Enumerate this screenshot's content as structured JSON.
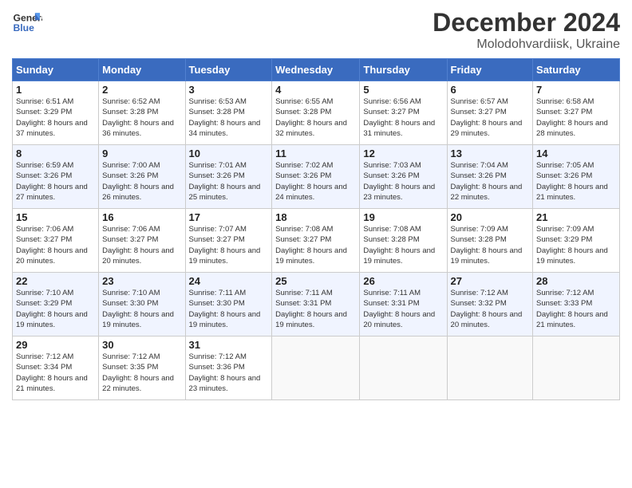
{
  "header": {
    "logo_line1": "General",
    "logo_line2": "Blue",
    "month": "December 2024",
    "location": "Molodohvardiisk, Ukraine"
  },
  "weekdays": [
    "Sunday",
    "Monday",
    "Tuesday",
    "Wednesday",
    "Thursday",
    "Friday",
    "Saturday"
  ],
  "weeks": [
    [
      {
        "day": "1",
        "sunrise": "Sunrise: 6:51 AM",
        "sunset": "Sunset: 3:29 PM",
        "daylight": "Daylight: 8 hours and 37 minutes."
      },
      {
        "day": "2",
        "sunrise": "Sunrise: 6:52 AM",
        "sunset": "Sunset: 3:28 PM",
        "daylight": "Daylight: 8 hours and 36 minutes."
      },
      {
        "day": "3",
        "sunrise": "Sunrise: 6:53 AM",
        "sunset": "Sunset: 3:28 PM",
        "daylight": "Daylight: 8 hours and 34 minutes."
      },
      {
        "day": "4",
        "sunrise": "Sunrise: 6:55 AM",
        "sunset": "Sunset: 3:28 PM",
        "daylight": "Daylight: 8 hours and 32 minutes."
      },
      {
        "day": "5",
        "sunrise": "Sunrise: 6:56 AM",
        "sunset": "Sunset: 3:27 PM",
        "daylight": "Daylight: 8 hours and 31 minutes."
      },
      {
        "day": "6",
        "sunrise": "Sunrise: 6:57 AM",
        "sunset": "Sunset: 3:27 PM",
        "daylight": "Daylight: 8 hours and 29 minutes."
      },
      {
        "day": "7",
        "sunrise": "Sunrise: 6:58 AM",
        "sunset": "Sunset: 3:27 PM",
        "daylight": "Daylight: 8 hours and 28 minutes."
      }
    ],
    [
      {
        "day": "8",
        "sunrise": "Sunrise: 6:59 AM",
        "sunset": "Sunset: 3:26 PM",
        "daylight": "Daylight: 8 hours and 27 minutes."
      },
      {
        "day": "9",
        "sunrise": "Sunrise: 7:00 AM",
        "sunset": "Sunset: 3:26 PM",
        "daylight": "Daylight: 8 hours and 26 minutes."
      },
      {
        "day": "10",
        "sunrise": "Sunrise: 7:01 AM",
        "sunset": "Sunset: 3:26 PM",
        "daylight": "Daylight: 8 hours and 25 minutes."
      },
      {
        "day": "11",
        "sunrise": "Sunrise: 7:02 AM",
        "sunset": "Sunset: 3:26 PM",
        "daylight": "Daylight: 8 hours and 24 minutes."
      },
      {
        "day": "12",
        "sunrise": "Sunrise: 7:03 AM",
        "sunset": "Sunset: 3:26 PM",
        "daylight": "Daylight: 8 hours and 23 minutes."
      },
      {
        "day": "13",
        "sunrise": "Sunrise: 7:04 AM",
        "sunset": "Sunset: 3:26 PM",
        "daylight": "Daylight: 8 hours and 22 minutes."
      },
      {
        "day": "14",
        "sunrise": "Sunrise: 7:05 AM",
        "sunset": "Sunset: 3:26 PM",
        "daylight": "Daylight: 8 hours and 21 minutes."
      }
    ],
    [
      {
        "day": "15",
        "sunrise": "Sunrise: 7:06 AM",
        "sunset": "Sunset: 3:27 PM",
        "daylight": "Daylight: 8 hours and 20 minutes."
      },
      {
        "day": "16",
        "sunrise": "Sunrise: 7:06 AM",
        "sunset": "Sunset: 3:27 PM",
        "daylight": "Daylight: 8 hours and 20 minutes."
      },
      {
        "day": "17",
        "sunrise": "Sunrise: 7:07 AM",
        "sunset": "Sunset: 3:27 PM",
        "daylight": "Daylight: 8 hours and 19 minutes."
      },
      {
        "day": "18",
        "sunrise": "Sunrise: 7:08 AM",
        "sunset": "Sunset: 3:27 PM",
        "daylight": "Daylight: 8 hours and 19 minutes."
      },
      {
        "day": "19",
        "sunrise": "Sunrise: 7:08 AM",
        "sunset": "Sunset: 3:28 PM",
        "daylight": "Daylight: 8 hours and 19 minutes."
      },
      {
        "day": "20",
        "sunrise": "Sunrise: 7:09 AM",
        "sunset": "Sunset: 3:28 PM",
        "daylight": "Daylight: 8 hours and 19 minutes."
      },
      {
        "day": "21",
        "sunrise": "Sunrise: 7:09 AM",
        "sunset": "Sunset: 3:29 PM",
        "daylight": "Daylight: 8 hours and 19 minutes."
      }
    ],
    [
      {
        "day": "22",
        "sunrise": "Sunrise: 7:10 AM",
        "sunset": "Sunset: 3:29 PM",
        "daylight": "Daylight: 8 hours and 19 minutes."
      },
      {
        "day": "23",
        "sunrise": "Sunrise: 7:10 AM",
        "sunset": "Sunset: 3:30 PM",
        "daylight": "Daylight: 8 hours and 19 minutes."
      },
      {
        "day": "24",
        "sunrise": "Sunrise: 7:11 AM",
        "sunset": "Sunset: 3:30 PM",
        "daylight": "Daylight: 8 hours and 19 minutes."
      },
      {
        "day": "25",
        "sunrise": "Sunrise: 7:11 AM",
        "sunset": "Sunset: 3:31 PM",
        "daylight": "Daylight: 8 hours and 19 minutes."
      },
      {
        "day": "26",
        "sunrise": "Sunrise: 7:11 AM",
        "sunset": "Sunset: 3:31 PM",
        "daylight": "Daylight: 8 hours and 20 minutes."
      },
      {
        "day": "27",
        "sunrise": "Sunrise: 7:12 AM",
        "sunset": "Sunset: 3:32 PM",
        "daylight": "Daylight: 8 hours and 20 minutes."
      },
      {
        "day": "28",
        "sunrise": "Sunrise: 7:12 AM",
        "sunset": "Sunset: 3:33 PM",
        "daylight": "Daylight: 8 hours and 21 minutes."
      }
    ],
    [
      {
        "day": "29",
        "sunrise": "Sunrise: 7:12 AM",
        "sunset": "Sunset: 3:34 PM",
        "daylight": "Daylight: 8 hours and 21 minutes."
      },
      {
        "day": "30",
        "sunrise": "Sunrise: 7:12 AM",
        "sunset": "Sunset: 3:35 PM",
        "daylight": "Daylight: 8 hours and 22 minutes."
      },
      {
        "day": "31",
        "sunrise": "Sunrise: 7:12 AM",
        "sunset": "Sunset: 3:36 PM",
        "daylight": "Daylight: 8 hours and 23 minutes."
      },
      null,
      null,
      null,
      null
    ]
  ]
}
